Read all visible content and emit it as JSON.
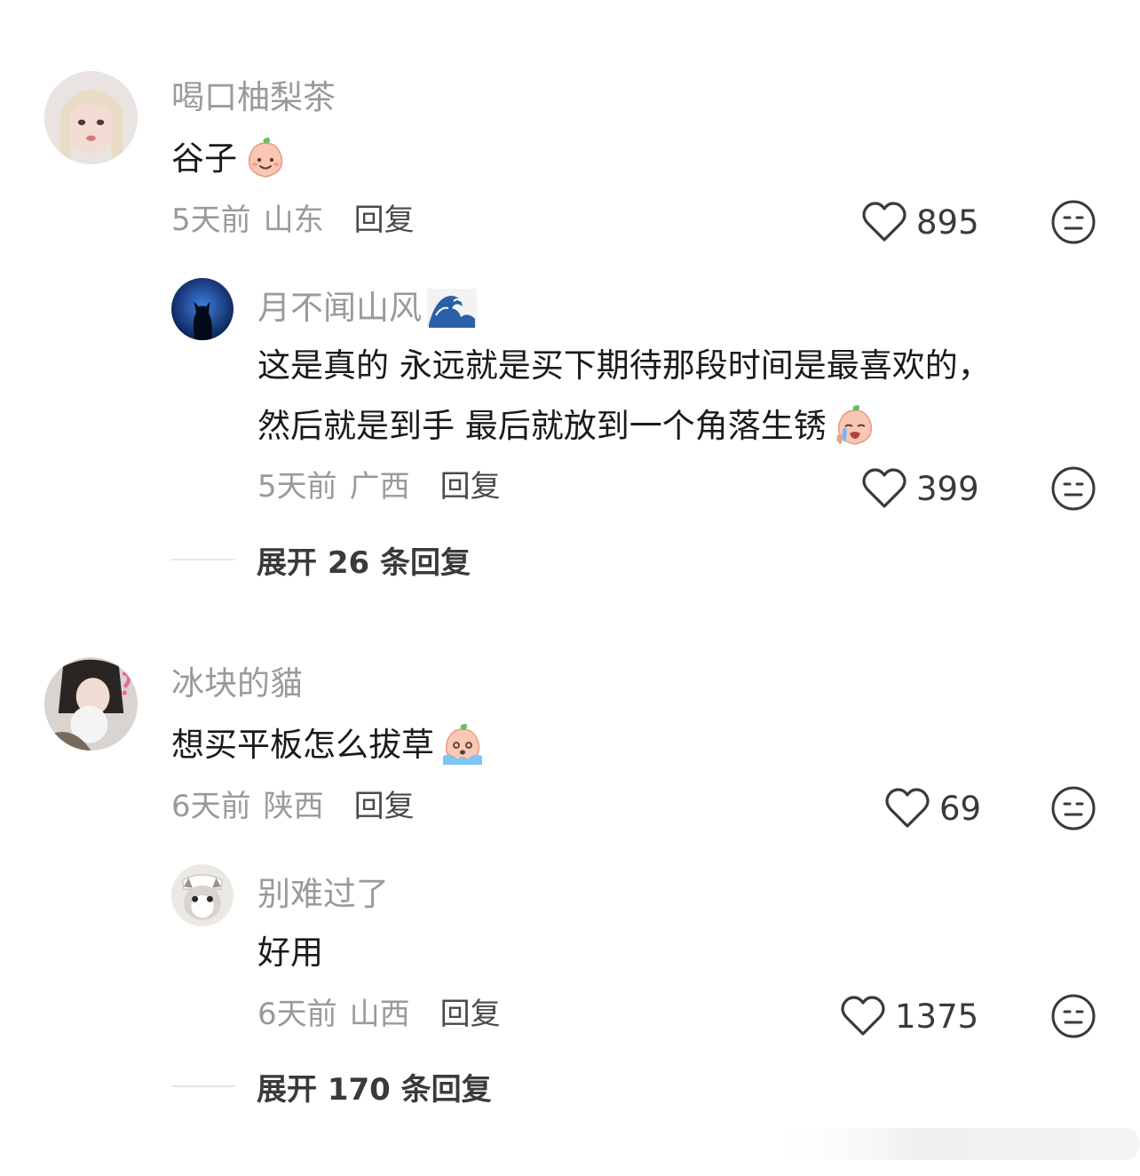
{
  "comments": [
    {
      "username": "喝口柚梨茶",
      "text_lines": [
        "谷子"
      ],
      "emoji": "peach-smile-emoji",
      "time": "5天前",
      "location": "山东",
      "reply_label": "回复",
      "likes": "895",
      "replies": [
        {
          "username": "月不闻山风",
          "username_emoji": "wave-emoji",
          "text_lines": [
            "这是真的 永远就是买下期待那段时间是最喜欢的，",
            "然后就是到手 最后就放到一个角落生锈"
          ],
          "emoji": "peach-cry-emoji",
          "time": "5天前",
          "location": "广西",
          "reply_label": "回复",
          "likes": "399"
        }
      ],
      "expand_label": "展开 26 条回复"
    },
    {
      "username": "冰块的貓",
      "text_lines": [
        "想买平板怎么拔草"
      ],
      "emoji": "peach-tears-emoji",
      "time": "6天前",
      "location": "陕西",
      "reply_label": "回复",
      "likes": "69",
      "replies": [
        {
          "username": "别难过了",
          "text_lines": [
            "好用"
          ],
          "time": "6天前",
          "location": "山西",
          "reply_label": "回复",
          "likes": "1375"
        }
      ],
      "expand_label": "展开 170 条回复"
    }
  ],
  "colors": {
    "username": "#9a9a9a",
    "text": "#1a1a1a",
    "meta": "#9a9a9a",
    "reply": "#4a4a4a",
    "icon": "#3a3a3a"
  }
}
